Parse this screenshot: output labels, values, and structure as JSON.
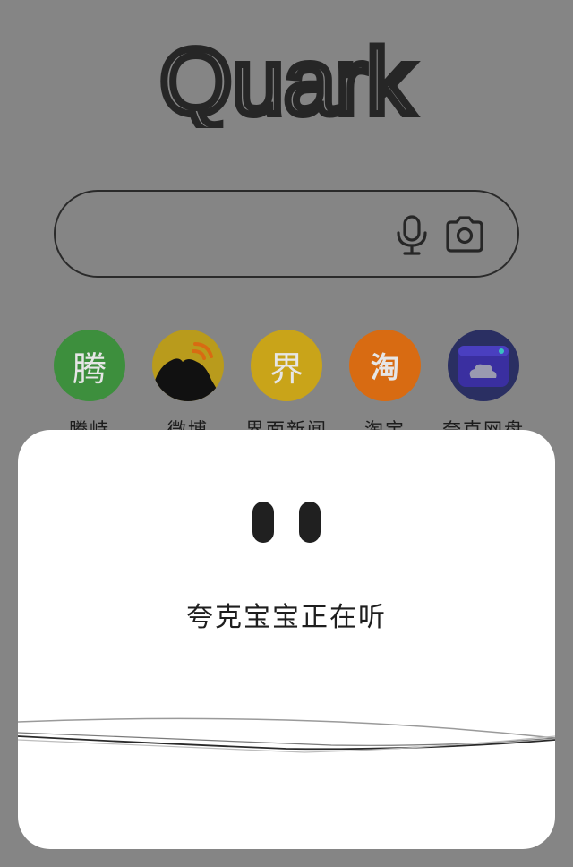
{
  "app": {
    "logo_text": "Quark"
  },
  "search": {
    "mic_icon": "microphone-icon",
    "camera_icon": "camera-icon"
  },
  "shortcuts": [
    {
      "label": "腾峙",
      "glyph": "腾",
      "color": "#3d8f3d"
    },
    {
      "label": "微博",
      "glyph": "",
      "color": "#b99b1c"
    },
    {
      "label": "界面新闻",
      "glyph": "界",
      "color": "#c9a419"
    },
    {
      "label": "淘宝",
      "glyph": "淘",
      "color": "#d86b12"
    },
    {
      "label": "夸克网盘",
      "glyph": "",
      "color": "#3a3899"
    }
  ],
  "voice": {
    "status_text": "夸克宝宝正在听"
  }
}
